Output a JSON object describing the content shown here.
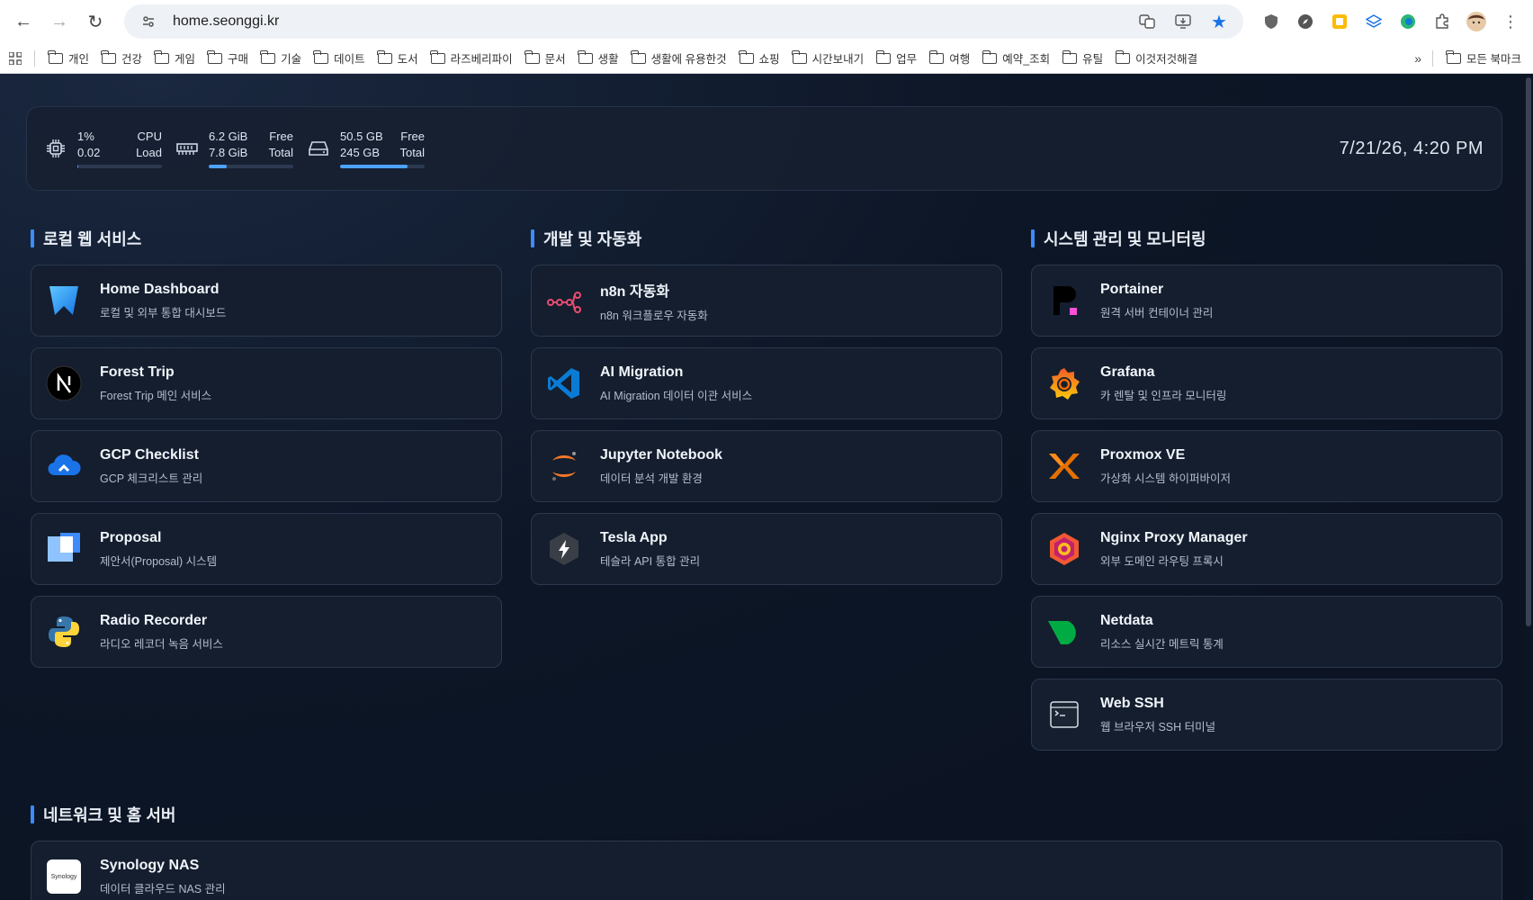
{
  "browser": {
    "url": "home.seonggi.kr",
    "bookmarks": [
      "개인",
      "건강",
      "게임",
      "구매",
      "기술",
      "데이트",
      "도서",
      "라즈베리파이",
      "문서",
      "생활",
      "생활에 유용한것",
      "쇼핑",
      "시간보내기",
      "업무",
      "여행",
      "예약_조회",
      "유틸",
      "이것저것해결"
    ],
    "bookmarks_more": "»",
    "all_bookmarks": "모든 북마크"
  },
  "stats": {
    "cpu": {
      "percent": "1%",
      "load_value": "0.02",
      "label1": "CPU",
      "label2": "Load",
      "fill": 0.01
    },
    "memory": {
      "free": "6.2 GiB",
      "total": "7.8 GiB",
      "label1": "Free",
      "label2": "Total",
      "fill": 0.21
    },
    "disk": {
      "free": "50.5 GB",
      "total": "245 GB",
      "label1": "Free",
      "label2": "Total",
      "fill": 0.8
    },
    "datetime": "7/21/26, 4:20 PM"
  },
  "sections": {
    "local": {
      "title": "로컬 웹 서비스",
      "items": [
        {
          "title": "Home Dashboard",
          "desc": "로컬 및 외부 통합 대시보드"
        },
        {
          "title": "Forest Trip",
          "desc": "Forest Trip 메인 서비스"
        },
        {
          "title": "GCP Checklist",
          "desc": "GCP 체크리스트 관리"
        },
        {
          "title": "Proposal",
          "desc": "제안서(Proposal) 시스템"
        },
        {
          "title": "Radio Recorder",
          "desc": "라디오 레코더 녹음 서비스"
        }
      ]
    },
    "dev": {
      "title": "개발 및 자동화",
      "items": [
        {
          "title": "n8n 자동화",
          "desc": "n8n 워크플로우 자동화"
        },
        {
          "title": "AI Migration",
          "desc": "AI Migration 데이터 이관 서비스"
        },
        {
          "title": "Jupyter Notebook",
          "desc": "데이터 분석 개발 환경"
        },
        {
          "title": "Tesla App",
          "desc": "테슬라 API 통합 관리"
        }
      ]
    },
    "system": {
      "title": "시스템 관리 및 모니터링",
      "items": [
        {
          "title": "Portainer",
          "desc": "원격 서버 컨테이너 관리"
        },
        {
          "title": "Grafana",
          "desc": "카 렌탈 및 인프라 모니터링"
        },
        {
          "title": "Proxmox VE",
          "desc": "가상화 시스템 하이퍼바이저"
        },
        {
          "title": "Nginx Proxy Manager",
          "desc": "외부 도메인 라우팅 프록시"
        },
        {
          "title": "Netdata",
          "desc": "리소스 실시간 메트릭 통계"
        },
        {
          "title": "Web SSH",
          "desc": "웹 브라우저 SSH 터미널"
        }
      ]
    },
    "network": {
      "title": "네트워크 및 홈 서버",
      "items": [
        {
          "title": "Synology NAS",
          "desc": "데이터 클라우드 NAS 관리",
          "logo_text": "Synology"
        }
      ]
    }
  },
  "colors": {
    "accent": "#3d8bfd",
    "bar_fill": "#4da3ff",
    "background": "#0d1626",
    "card": "#141e2e"
  }
}
